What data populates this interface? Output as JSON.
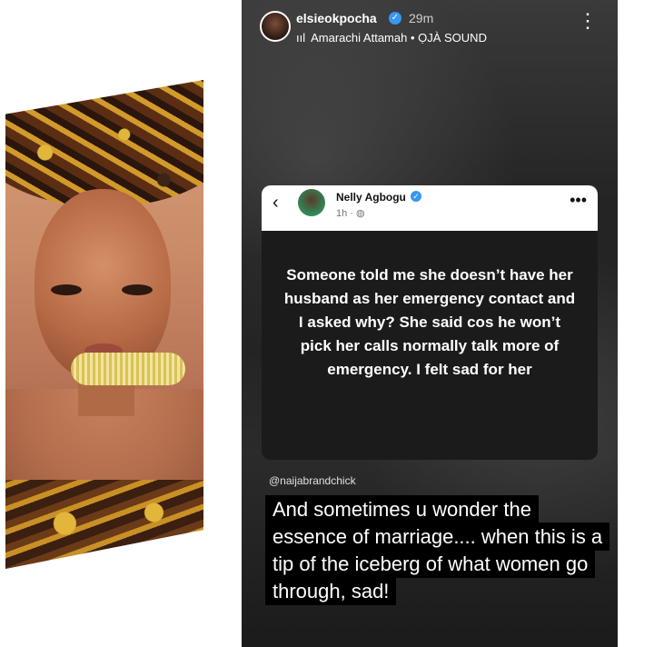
{
  "story": {
    "username": "elsieokpocha",
    "time": "29m",
    "music": "Amarachi Attamah • ỌJÀ SOUND"
  },
  "tweet": {
    "name": "Nelly Agbogu",
    "time": "1h · ",
    "text": "Someone told me she doesn’t have her husband as her emergency contact and I asked why? She said cos he won’t pick her calls normally talk more of emergency. I felt sad for her"
  },
  "caption": {
    "handle": "@naijabrandchick",
    "text": "And sometimes u wonder the essence of marriage.... when this is a tip of the iceberg of what women go through, sad!"
  }
}
